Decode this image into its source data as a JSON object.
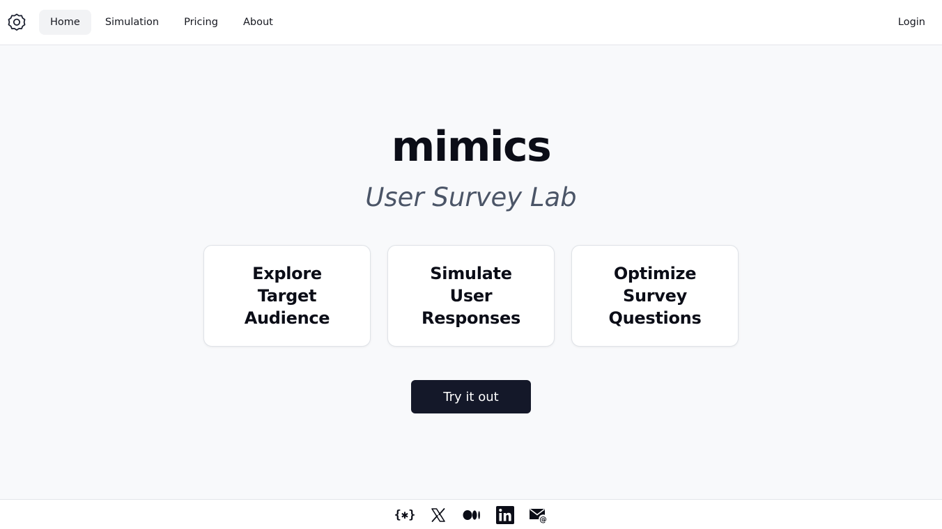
{
  "nav": {
    "items": [
      {
        "label": "Home",
        "active": true
      },
      {
        "label": "Simulation",
        "active": false
      },
      {
        "label": "Pricing",
        "active": false
      },
      {
        "label": "About",
        "active": false
      }
    ],
    "login_label": "Login"
  },
  "hero": {
    "title": "mimics",
    "subtitle": "User Survey Lab"
  },
  "features": [
    {
      "label": "Explore Target Audience"
    },
    {
      "label": "Simulate User Responses"
    },
    {
      "label": "Optimize Survey Questions"
    }
  ],
  "cta": {
    "label": "Try it out"
  },
  "footer": {
    "social": [
      {
        "icon": "code-brackets-icon",
        "glyph": "{✱}"
      },
      {
        "icon": "x-twitter-icon"
      },
      {
        "icon": "medium-icon"
      },
      {
        "icon": "linkedin-icon"
      },
      {
        "icon": "email-icon"
      }
    ]
  },
  "colors": {
    "background": "#f8f9fb",
    "cta_bg": "#141829",
    "subtitle": "#4b5567"
  }
}
